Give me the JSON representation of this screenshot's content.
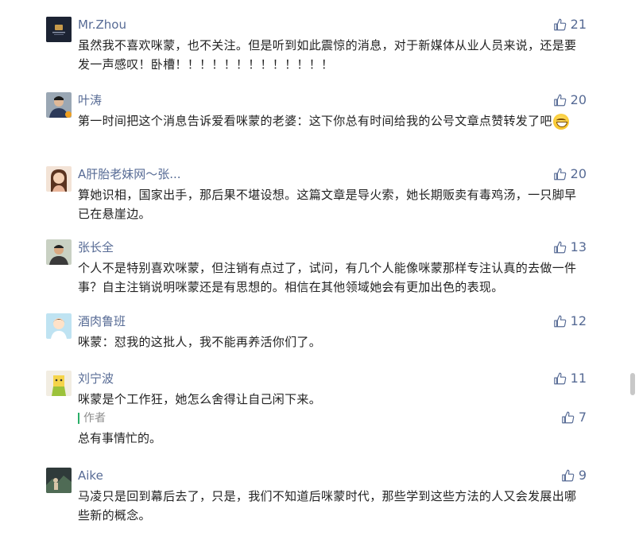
{
  "comments": [
    {
      "name": "Mr.Zhou",
      "likes": "21",
      "avatar": "logo-avatar-dark-navy",
      "text": "虽然我不喜欢咪蒙，也不关注。但是听到如此震惊的消息，对于新媒体从业人员来说，还是要发一声感叹！卧槽！！！！！！！！！！！！！"
    },
    {
      "name": "叶涛",
      "likes": "20",
      "avatar": "man-portrait-avatar",
      "text": "第一时间把这个消息告诉爱看咪蒙的老婆：这下你总有时间给我的公号文章点赞转发了吧",
      "emoji": "grin-emoji"
    },
    {
      "name": "A肝胎老妹网～张...",
      "likes": "20",
      "avatar": "woman-portrait-avatar",
      "text": "算她识相，国家出手，那后果不堪设想。这篇文章是导火索，她长期贩卖有毒鸡汤，一只脚早已在悬崖边。"
    },
    {
      "name": "张长全",
      "likes": "13",
      "avatar": "man-portrait-avatar",
      "text": "个人不是特别喜欢咪蒙，但注销有点过了，试问，有几个人能像咪蒙那样专注认真的去做一件事？自主注销说明咪蒙还是有思想的。相信在其他领域她会有更加出色的表现。"
    },
    {
      "name": "酒肉鲁班",
      "likes": "12",
      "avatar": "cartoon-avatar",
      "text": "咪蒙：怼我的这批人，我不能再养活你们了。"
    },
    {
      "name": "刘宁波",
      "likes": "11",
      "avatar": "cartoon-avatar",
      "text": "咪蒙是个工作狂，她怎么舍得让自己闲下来。",
      "reply": {
        "author_label": "作者",
        "likes": "7",
        "text": "总有事情忙的。"
      }
    },
    {
      "name": "Aike",
      "likes": "9",
      "avatar": "landscape-avatar",
      "text": "马凌只是回到幕后去了，只是，我们不知道后咪蒙时代，那些学到这些方法的人又会发展出哪些新的概念。"
    }
  ],
  "colors": {
    "name": "#576b95",
    "text": "#222222",
    "author_bar": "#2aae67"
  },
  "icons": {
    "like": "thumbs-up-icon"
  }
}
